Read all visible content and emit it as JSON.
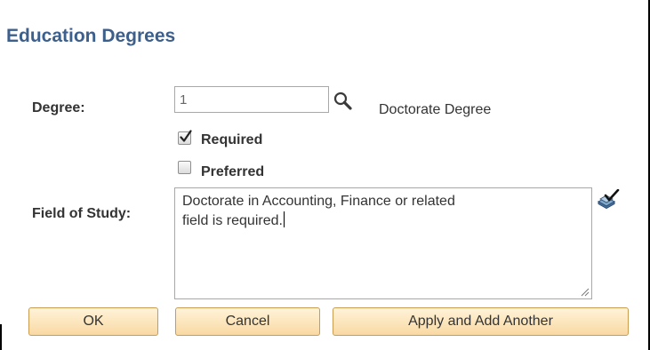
{
  "page": {
    "title": "Education Degrees"
  },
  "degree": {
    "label": "Degree:",
    "value": "1",
    "description": "Doctorate Degree"
  },
  "options": {
    "required": {
      "label": "Required",
      "checked": true
    },
    "preferred": {
      "label": "Preferred",
      "checked": false
    }
  },
  "field_of_study": {
    "label": "Field of Study:",
    "value": "Doctorate in Accounting, Finance or related\nfield is required."
  },
  "buttons": {
    "ok": "OK",
    "cancel": "Cancel",
    "apply_add": "Apply and Add Another"
  },
  "icons": {
    "lookup": "magnifier-icon",
    "spell_check": "spell-check-icon"
  },
  "colors": {
    "title": "#3c5f8c",
    "button_bg": "#f9d9a3",
    "button_border": "#c99c52"
  }
}
